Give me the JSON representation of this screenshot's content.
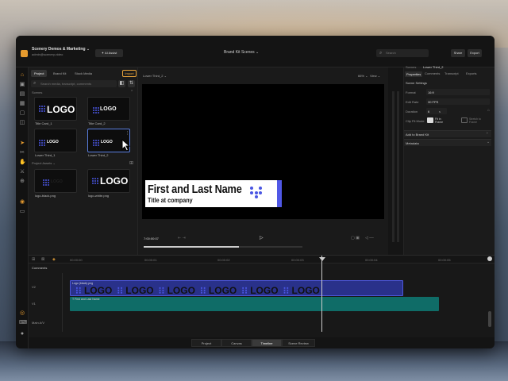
{
  "header": {
    "workspace_name": "Scenery Demos & Marketing ⌄",
    "workspace_email": "admin@scenery.video",
    "ai_assist_label": "✦ AI Assist",
    "project_title": "Brand Kit Scenes ⌄",
    "search_placeholder": "Search",
    "share_label": "Share",
    "export_label": "Export"
  },
  "library": {
    "tabs": [
      "Project",
      "Brand Kit",
      "Stock Media"
    ],
    "import_label": "Import",
    "search_placeholder": "Search media, transcript, comments",
    "scenes_heading": "Scenes",
    "project_assets_heading": "Project Assets ⌄",
    "logo_word": "LOGO",
    "scenes": [
      {
        "label": "Title Card_1"
      },
      {
        "label": "Title Card_2"
      },
      {
        "label": "Lower Third_1"
      },
      {
        "label": "Lower Third_2"
      }
    ],
    "assets": [
      {
        "label": "logo-black.png"
      },
      {
        "label": "logo-white.png"
      }
    ]
  },
  "stage": {
    "scene_selector": "Lower Third_2 ⌄",
    "zoom": "66% ⌄",
    "view_label": "View ⌄",
    "lower_third_title": "First and Last Name",
    "lower_third_subtitle": "Title at company",
    "timecode": "7:00:00:07",
    "playhead_progress": 0.6
  },
  "properties": {
    "breadcrumb_scene": "Scenes",
    "breadcrumb_item": "Lower Third_2",
    "tabs": [
      "Properties",
      "Comments",
      "Transcript",
      "Exports"
    ],
    "section_title": "Scene Settings",
    "rows": [
      {
        "label": "Format",
        "value": "16:9"
      },
      {
        "label": "Edit Rate",
        "value": "30 FPS"
      },
      {
        "label": "Duration",
        "value": "6"
      },
      {
        "label": "Clip Fit Mode",
        "value": "Fit in Frame"
      }
    ],
    "secondary_value": "Stretch to Frame",
    "duration_unit": "s",
    "add_to_brand_kit_label": "Add to Brand Kit",
    "metadata_label": "Metadata"
  },
  "timeline": {
    "ruler_ticks": [
      "00:00:00",
      "00:00:01",
      "00:00:02",
      "00:00:03",
      "00:00:04",
      "00:00:05"
    ],
    "tracks": [
      {
        "label": "Comments"
      },
      {
        "label": "V2"
      },
      {
        "label": "V1"
      },
      {
        "label": "Main A/V"
      }
    ],
    "clip_logo_name": "Logo (black).png",
    "clip_text_name": "T First and Last Name"
  },
  "bottom_tabs": {
    "items": [
      "Project",
      "Canvas",
      "Timeline",
      "Scene Review"
    ],
    "active_index": 2
  },
  "colors": {
    "accent_orange": "#e8a33a",
    "brand_blue": "#4a56e2",
    "text_clip_teal": "#0f6c67"
  }
}
